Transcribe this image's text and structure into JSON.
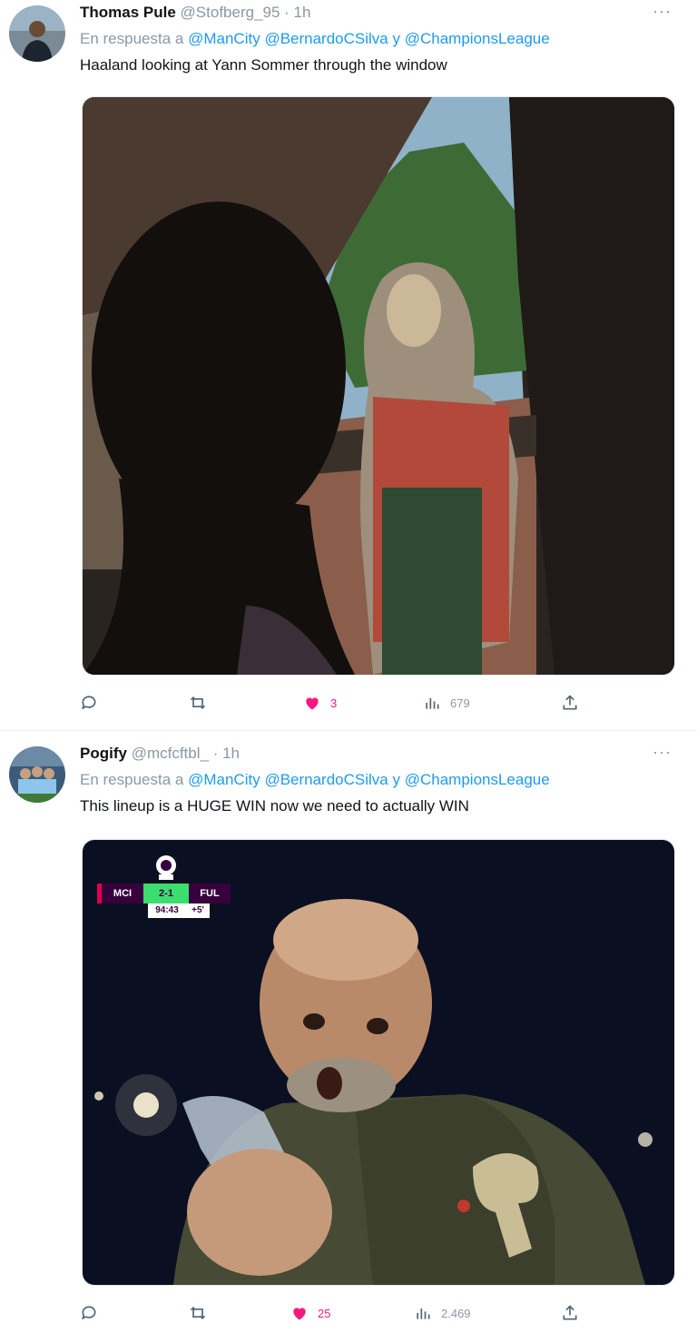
{
  "tweets": [
    {
      "name": "Thomas Pule",
      "handle": "@Stofberg_95",
      "time": "· 1h",
      "more": "···",
      "reply_prefix": "En respuesta a",
      "mentions": [
        "@ManCity",
        "@BernardoCSilva",
        "@ChampionsLeague"
      ],
      "mention_join": "y",
      "text": "Haaland looking at Yann Sommer through the window",
      "stats": {
        "replies": "",
        "reposts": "",
        "likes": "3",
        "views": "679"
      },
      "liked": true
    },
    {
      "name": "Pogify",
      "handle": "@mcfcftbl_",
      "time": "· 1h",
      "more": "···",
      "reply_prefix": "En respuesta a",
      "mentions": [
        "@ManCity",
        "@BernardoCSilva",
        "@ChampionsLeague"
      ],
      "mention_join": "y",
      "text": "This lineup is a HUGE WIN now we need to actually WIN",
      "stats": {
        "replies": "",
        "reposts": "",
        "likes": "25",
        "views": "2.469"
      },
      "liked": true,
      "scorebug": {
        "home": "MCI",
        "score": "2-1",
        "away": "FUL",
        "clock": "94:43",
        "added": "+5'"
      }
    }
  ],
  "colors": {
    "accent": "#1d9bf0",
    "like": "#f91880",
    "muted": "#8b98a5"
  },
  "icons": [
    "reply-icon",
    "repost-icon",
    "heart-icon",
    "views-icon",
    "share-icon",
    "more-icon",
    "premier-league-logo-icon"
  ]
}
